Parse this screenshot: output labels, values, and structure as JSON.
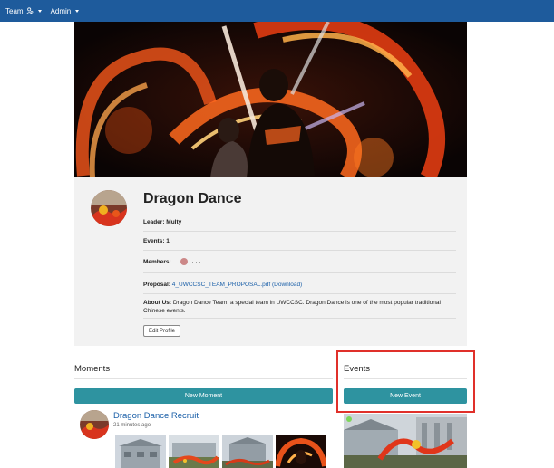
{
  "nav": {
    "team_label": "Team",
    "admin_label": "Admin"
  },
  "team": {
    "name": "Dragon Dance",
    "leader_label": "Leader:",
    "leader": "Multy",
    "events_label": "Events:",
    "events": "1",
    "members_label": "Members:",
    "members_more": "· · ·",
    "proposal_label": "Proposal:",
    "proposal_file": "4_UWCCSC_TEAM_PROPOSAL.pdf",
    "proposal_download": "(Download)",
    "about_label": "About Us:",
    "about_text": "Dragon Dance Team, a special team in UWCCSC. Dragon Dance is one of the most popular traditional Chinese events.",
    "edit_button": "Edit Profile"
  },
  "moments": {
    "title": "Moments",
    "new_button": "New Moment",
    "post": {
      "title": "Dragon Dance Recruit",
      "time": "21 minutes ago"
    }
  },
  "events": {
    "title": "Events",
    "new_button": "New Event"
  },
  "colors": {
    "navbar": "#1e5b9c",
    "teal": "#2e93a0",
    "link": "#1a5fa8",
    "highlight": "#e0302a"
  }
}
